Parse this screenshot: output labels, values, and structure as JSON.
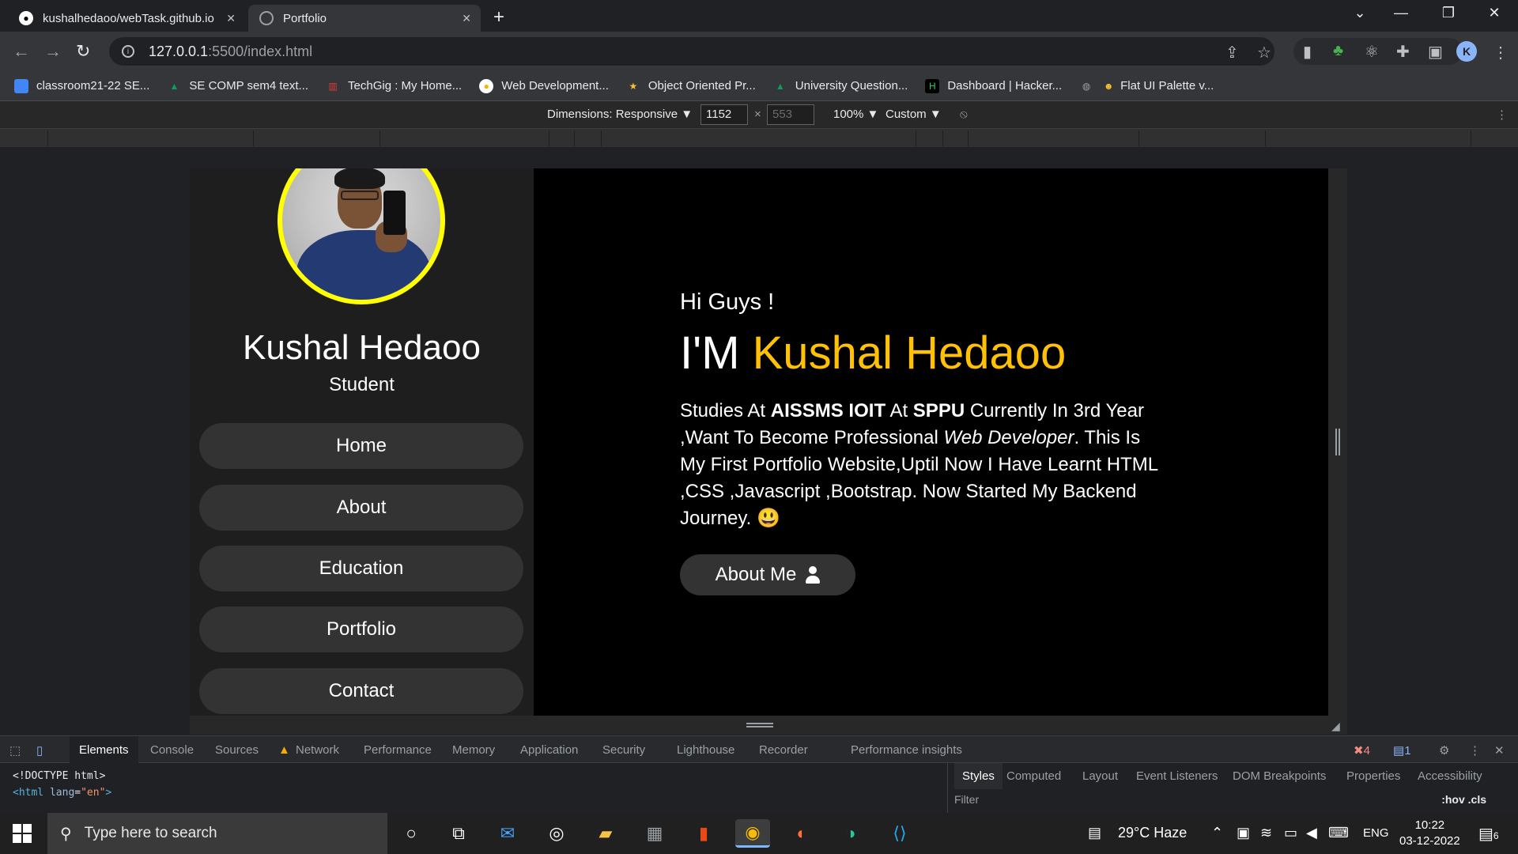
{
  "browser": {
    "tabs": [
      {
        "title": "kushalhedaoo/webTask.github.io",
        "icon": "github-icon"
      },
      {
        "title": "Portfolio",
        "icon": "globe-icon"
      }
    ],
    "url_host": "127.0.0.1",
    "url_path": ":5500/index.html",
    "profile_initial": "K",
    "bookmarks": [
      {
        "label": "classroom21-22 SE...",
        "color": "#4285f4"
      },
      {
        "label": "SE COMP sem4 text...",
        "color": "#0f9d58"
      },
      {
        "label": "TechGig : My Home...",
        "color": "#e53935"
      },
      {
        "label": "Web Development...",
        "color": "#f4b400"
      },
      {
        "label": "Object Oriented Pr...",
        "color": "#fbc02d"
      },
      {
        "label": "University Question...",
        "color": "#0f9d58"
      },
      {
        "label": "Dashboard | Hacker...",
        "color": "#2ec866"
      },
      {
        "label": "Flat UI Palette v...",
        "color": "#9aa0a6"
      }
    ]
  },
  "device_toolbar": {
    "dimensions_label": "Dimensions: Responsive ▼",
    "width": "1152",
    "height_placeholder": "553",
    "times": "×",
    "zoom": "100% ▼",
    "throttle": "Custom ▼"
  },
  "page": {
    "name": "Kushal Hedaoo",
    "role": "Student",
    "nav": [
      "Home",
      "About",
      "Education",
      "Portfolio",
      "Contact"
    ],
    "greeting": "Hi Guys !",
    "headline_prefix": "I'M ",
    "headline_name": "Kushal Hedaoo",
    "bio_1": "Studies At ",
    "bio_bold_1": "AISSMS IOIT",
    "bio_2": " At ",
    "bio_bold_2": "SPPU",
    "bio_3": " Currently In 3rd Year ,Want To Become Professional ",
    "bio_italic": "Web Developer",
    "bio_4": ". This Is My First Portfolio Website,Uptil Now I Have Learnt HTML ,CSS ,Javascript ,Bootstrap. Now Started My Backend Journey.",
    "bio_emoji": "😃",
    "about_button": "About Me",
    "accent_color": "#ffc107",
    "avatar_ring_color": "#ffff00"
  },
  "devtools": {
    "tabs": [
      "Elements",
      "Console",
      "Sources",
      "Network",
      "Performance",
      "Memory",
      "Application",
      "Security",
      "Lighthouse",
      "Recorder",
      "Performance insights"
    ],
    "errors": "4",
    "messages": "1",
    "dom_line_1": "<!DOCTYPE html>",
    "dom_line_2_tag": "<html ",
    "dom_line_2_attr": "lang",
    "dom_line_2_val": "\"en\"",
    "dom_line_2_end": ">",
    "styles_tabs": [
      "Styles",
      "Computed",
      "Layout",
      "Event Listeners",
      "DOM Breakpoints",
      "Properties",
      "Accessibility"
    ],
    "filter_placeholder": "Filter",
    "filter_tools": ":hov  .cls"
  },
  "taskbar": {
    "search_placeholder": "Type here to search",
    "weather": "29°C  Haze",
    "language": "ENG",
    "time": "10:22",
    "date": "03-12-2022",
    "notifications": "6"
  }
}
